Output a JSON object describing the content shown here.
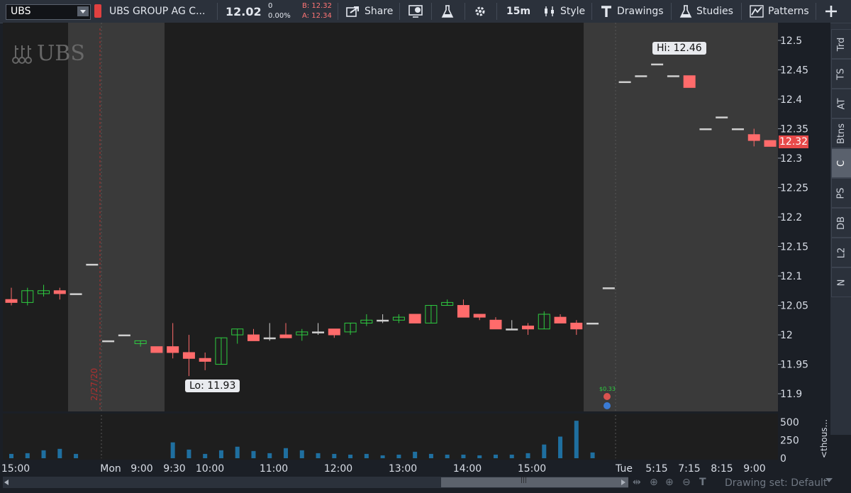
{
  "toolbar": {
    "symbol": "UBS",
    "company": "UBS GROUP AG C...",
    "last_price": "12.02",
    "net_change": "0",
    "pct_change": "0.00%",
    "bid": "B: 12.32",
    "ask": "A: 12.34",
    "share_label": "Share",
    "timeframe": "15m",
    "style_label": "Style",
    "drawings_label": "Drawings",
    "studies_label": "Studies",
    "patterns_label": "Patterns"
  },
  "chart": {
    "watermark": "UBS",
    "hi_label": "Hi: 12.46",
    "lo_label": "Lo: 11.93",
    "current_price_tag": "12.32",
    "dividend_label": "$0.33",
    "date_marker": "2/27/20",
    "price_ticks": [
      "12.5",
      "12.45",
      "12.4",
      "12.35",
      "12.3",
      "12.25",
      "12.2",
      "12.15",
      "12.1",
      "12.05",
      "12",
      "11.95",
      "11.9"
    ],
    "volume_ticks": [
      "500",
      "250",
      "0"
    ],
    "volume_unit": "<thous...",
    "time_ticks": [
      "15:00",
      "Mon",
      "9:00",
      "9:30",
      "10:00",
      "11:00",
      "12:00",
      "13:00",
      "14:00",
      "15:00",
      "Tue",
      "5:15",
      "7:15",
      "8:15",
      "9:00"
    ]
  },
  "right_tabs": [
    "Trd",
    "TS",
    "AT",
    "Btns",
    "C",
    "PS",
    "DB",
    "L2",
    "N"
  ],
  "active_tab": "C",
  "status": {
    "drawing_set": "Drawing set: Default"
  },
  "colors": {
    "up": "#2ecc40",
    "down": "#ff6b6b",
    "volume": "#1f6f9f",
    "price_tag": "#e84a4a"
  },
  "chart_data": {
    "type": "candlestick",
    "ylim": [
      11.87,
      12.53
    ],
    "volume_ylim": [
      0,
      600
    ],
    "candles": [
      {
        "t": "15:00",
        "o": 12.06,
        "h": 12.08,
        "l": 12.05,
        "c": 12.055
      },
      {
        "t": "15:15",
        "o": 12.055,
        "h": 12.08,
        "l": 12.05,
        "c": 12.075
      },
      {
        "t": "15:30",
        "o": 12.07,
        "h": 12.085,
        "l": 12.065,
        "c": 12.075
      },
      {
        "t": "15:45",
        "o": 12.075,
        "h": 12.08,
        "l": 12.06,
        "c": 12.07
      },
      {
        "t": "16:00",
        "o": 12.07,
        "h": 12.07,
        "l": 12.07,
        "c": 12.07
      },
      {
        "t": "pre-a",
        "o": 12.12,
        "h": 12.12,
        "l": 12.12,
        "c": 12.12
      },
      {
        "t": "pre-b",
        "o": 11.99,
        "h": 11.99,
        "l": 11.99,
        "c": 11.99
      },
      {
        "t": "pre-c",
        "o": 12.0,
        "h": 12.0,
        "l": 12.0,
        "c": 12.0
      },
      {
        "t": "9:00",
        "o": 11.985,
        "h": 11.99,
        "l": 11.98,
        "c": 11.99
      },
      {
        "t": "9:15",
        "o": 11.98,
        "h": 11.98,
        "l": 11.97,
        "c": 11.97
      },
      {
        "t": "9:30",
        "o": 11.98,
        "h": 12.02,
        "l": 11.96,
        "c": 11.97
      },
      {
        "t": "9:45",
        "o": 11.97,
        "h": 12.0,
        "l": 11.93,
        "c": 11.96
      },
      {
        "t": "10:00",
        "o": 11.96,
        "h": 11.97,
        "l": 11.94,
        "c": 11.955
      },
      {
        "t": "10:15",
        "o": 11.95,
        "h": 11.995,
        "l": 11.95,
        "c": 11.995
      },
      {
        "t": "10:30",
        "o": 12.0,
        "h": 12.01,
        "l": 11.985,
        "c": 12.01
      },
      {
        "t": "10:45",
        "o": 12.0,
        "h": 12.01,
        "l": 11.99,
        "c": 11.99
      },
      {
        "t": "11:00",
        "o": 11.995,
        "h": 12.02,
        "l": 11.99,
        "c": 11.995
      },
      {
        "t": "11:15",
        "o": 12.0,
        "h": 12.02,
        "l": 11.995,
        "c": 11.995
      },
      {
        "t": "11:30",
        "o": 12.0,
        "h": 12.01,
        "l": 11.99,
        "c": 12.005
      },
      {
        "t": "11:45",
        "o": 12.005,
        "h": 12.02,
        "l": 12.0,
        "c": 12.005
      },
      {
        "t": "12:00",
        "o": 12.01,
        "h": 12.01,
        "l": 11.995,
        "c": 12.0
      },
      {
        "t": "12:15",
        "o": 12.005,
        "h": 12.02,
        "l": 12.0,
        "c": 12.02
      },
      {
        "t": "12:30",
        "o": 12.02,
        "h": 12.035,
        "l": 12.015,
        "c": 12.025
      },
      {
        "t": "12:45",
        "o": 12.025,
        "h": 12.035,
        "l": 12.02,
        "c": 12.025
      },
      {
        "t": "13:00",
        "o": 12.025,
        "h": 12.035,
        "l": 12.02,
        "c": 12.03
      },
      {
        "t": "13:15",
        "o": 12.035,
        "h": 12.035,
        "l": 12.02,
        "c": 12.02
      },
      {
        "t": "13:30",
        "o": 12.02,
        "h": 12.05,
        "l": 12.02,
        "c": 12.05
      },
      {
        "t": "13:45",
        "o": 12.05,
        "h": 12.06,
        "l": 12.05,
        "c": 12.055
      },
      {
        "t": "14:00",
        "o": 12.05,
        "h": 12.06,
        "l": 12.03,
        "c": 12.03
      },
      {
        "t": "14:15",
        "o": 12.035,
        "h": 12.035,
        "l": 12.025,
        "c": 12.03
      },
      {
        "t": "14:30",
        "o": 12.025,
        "h": 12.03,
        "l": 12.01,
        "c": 12.01
      },
      {
        "t": "14:45",
        "o": 12.01,
        "h": 12.025,
        "l": 12.01,
        "c": 12.01
      },
      {
        "t": "15:00",
        "o": 12.015,
        "h": 12.02,
        "l": 12.0,
        "c": 12.01
      },
      {
        "t": "15:15",
        "o": 12.01,
        "h": 12.04,
        "l": 12.01,
        "c": 12.035
      },
      {
        "t": "15:30",
        "o": 12.03,
        "h": 12.035,
        "l": 12.02,
        "c": 12.02
      },
      {
        "t": "15:45",
        "o": 12.02,
        "h": 12.025,
        "l": 12.0,
        "c": 12.01
      },
      {
        "t": "post-a",
        "o": 12.02,
        "h": 12.02,
        "l": 12.02,
        "c": 12.02
      },
      {
        "t": "post-b",
        "o": 12.08,
        "h": 12.08,
        "l": 12.08,
        "c": 12.08
      },
      {
        "t": "Tue-a",
        "o": 12.43,
        "h": 12.43,
        "l": 12.43,
        "c": 12.43
      },
      {
        "t": "Tue-b",
        "o": 12.44,
        "h": 12.44,
        "l": 12.44,
        "c": 12.44
      },
      {
        "t": "5:15",
        "o": 12.46,
        "h": 12.46,
        "l": 12.46,
        "c": 12.46
      },
      {
        "t": "5:30",
        "o": 12.44,
        "h": 12.44,
        "l": 12.44,
        "c": 12.44
      },
      {
        "t": "7:15",
        "o": 12.44,
        "h": 12.44,
        "l": 12.42,
        "c": 12.42
      },
      {
        "t": "7:30",
        "o": 12.35,
        "h": 12.35,
        "l": 12.35,
        "c": 12.35
      },
      {
        "t": "8:15",
        "o": 12.37,
        "h": 12.37,
        "l": 12.37,
        "c": 12.37
      },
      {
        "t": "8:30",
        "o": 12.35,
        "h": 12.35,
        "l": 12.35,
        "c": 12.35
      },
      {
        "t": "9:00",
        "o": 12.34,
        "h": 12.35,
        "l": 12.32,
        "c": 12.33
      },
      {
        "t": "9:15",
        "o": 12.33,
        "h": 12.33,
        "l": 12.32,
        "c": 12.32
      }
    ],
    "volume": [
      60,
      70,
      110,
      130,
      60,
      0,
      0,
      0,
      0,
      0,
      220,
      120,
      60,
      110,
      160,
      100,
      70,
      140,
      110,
      70,
      60,
      50,
      60,
      40,
      50,
      90,
      60,
      50,
      50,
      40,
      50,
      50,
      70,
      190,
      300,
      520,
      80,
      0,
      0,
      0,
      0,
      0,
      0,
      0,
      0,
      0,
      0,
      0
    ]
  }
}
